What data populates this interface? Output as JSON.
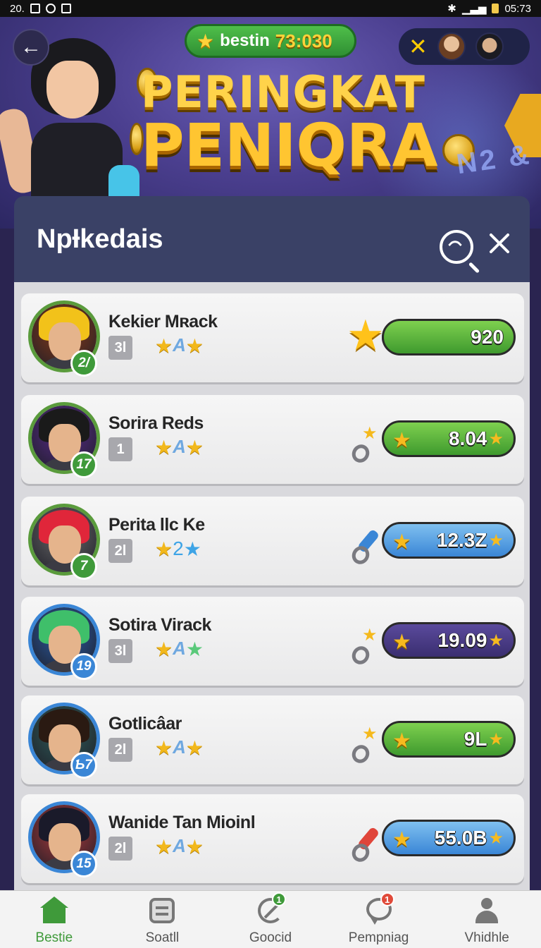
{
  "status_bar": {
    "left_text": "20.",
    "right_time": "05:73"
  },
  "header": {
    "coin_label": "bestin",
    "coin_value": "73:030",
    "title_line1": "PERINGKAT",
    "title_line2": "PENIQRA",
    "hero_glyphs": "N2 &"
  },
  "panel": {
    "title": "NpƗkedais"
  },
  "colors": {
    "accent_green": "#3f9a3a",
    "panel_header": "#3a4166",
    "accent_blue": "#3a86d6",
    "accent_purple": "#3a2e70",
    "star": "#f2b81c"
  },
  "players": [
    {
      "name": "Kekier Mʀack",
      "badge": "2/",
      "rank": "3l",
      "stars_mid": "A",
      "score": "920",
      "score_tail": "",
      "pill_color": "green",
      "side_icon": "star-pet",
      "avatar_hair": "#f2c21a",
      "avatar_bg": "#8a3a18",
      "badge_color": "green"
    },
    {
      "name": "Sorira Reds",
      "badge": "17",
      "rank": "1",
      "stars_mid": "A",
      "score": "8.04",
      "score_tail": "★",
      "pill_color": "green",
      "side_icon": "tool",
      "avatar_hair": "#1a1a1a",
      "avatar_bg": "#5a2a8a",
      "badge_color": "green"
    },
    {
      "name": "Perita llc Ke",
      "badge": "7",
      "rank": "2l",
      "stars_mid": "2",
      "score": "12.3Z",
      "score_tail": "★",
      "pill_color": "blue",
      "side_icon": "tool-blue",
      "avatar_hair": "#e0263a",
      "avatar_bg": "#6a6a6a",
      "badge_color": "green"
    },
    {
      "name": "Sotira Virack",
      "badge": "19",
      "rank": "3l",
      "stars_mid": "A",
      "score": "19.09",
      "score_tail": "★",
      "pill_color": "purple",
      "side_icon": "tool",
      "avatar_hair": "#3fbf6a",
      "avatar_bg": "#2a5ea8",
      "badge_color": "blue"
    },
    {
      "name": "Gotlicâar",
      "badge": "Ƅ7",
      "rank": "2l",
      "stars_mid": "A",
      "score": "9L",
      "score_tail": "★",
      "pill_color": "green",
      "side_icon": "tool",
      "avatar_hair": "#2a1a12",
      "avatar_bg": "#2f5e5a",
      "badge_color": "blue"
    },
    {
      "name": "Wanide Tan Mioinl",
      "badge": "15",
      "rank": "2l",
      "stars_mid": "A",
      "score": "55.0B",
      "score_tail": "★",
      "pill_color": "blue",
      "side_icon": "tool-red",
      "avatar_hair": "#1a1a2a",
      "avatar_bg": "#b03a3a",
      "badge_color": "blue"
    }
  ],
  "bottom_nav": [
    {
      "label": "Bestie",
      "icon": "home-icon",
      "active": true,
      "badge": ""
    },
    {
      "label": "Soatll",
      "icon": "list-icon",
      "active": false,
      "badge": ""
    },
    {
      "label": "Goocid",
      "icon": "sync-icon",
      "active": false,
      "badge": "1"
    },
    {
      "label": "Pempniag",
      "icon": "chat-icon",
      "active": false,
      "badge": "1"
    },
    {
      "label": "Vhidhle",
      "icon": "profile-icon",
      "active": false,
      "badge": ""
    }
  ]
}
